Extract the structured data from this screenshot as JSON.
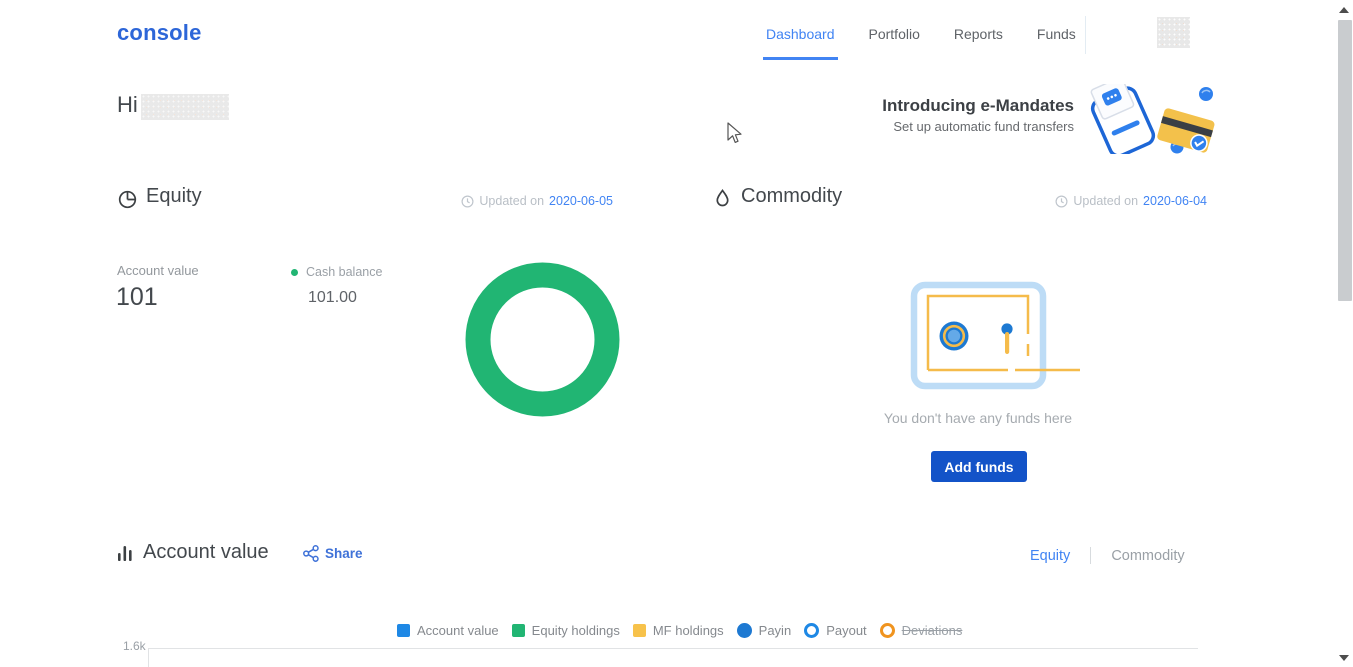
{
  "header": {
    "logo": "console",
    "nav": [
      {
        "label": "Dashboard",
        "active": true
      },
      {
        "label": "Portfolio",
        "active": false
      },
      {
        "label": "Reports",
        "active": false
      },
      {
        "label": "Funds",
        "active": false
      }
    ]
  },
  "greeting": {
    "prefix": "Hi"
  },
  "promo": {
    "title": "Introducing e-Mandates",
    "subtitle": "Set up automatic fund transfers"
  },
  "equity": {
    "title": "Equity",
    "updated_label": "Updated on",
    "updated_date": "2020-06-05",
    "account_value_label": "Account value",
    "account_value": "101",
    "cash_balance_label": "Cash balance",
    "cash_balance": "101.00"
  },
  "commodity": {
    "title": "Commodity",
    "updated_label": "Updated on",
    "updated_date": "2020-06-04",
    "empty_text": "You don't have any funds here",
    "add_funds_label": "Add funds"
  },
  "account_value_section": {
    "title": "Account value",
    "share_label": "Share",
    "toggle": [
      {
        "label": "Equity",
        "active": true
      },
      {
        "label": "Commodity",
        "active": false
      }
    ]
  },
  "equity_donut": {
    "type": "pie",
    "color": "#21b573",
    "series": [
      {
        "label": "Cash balance",
        "value": 101.0,
        "fraction": 1.0
      }
    ]
  },
  "chart_data": {
    "type": "line",
    "title": "Account value",
    "legend": [
      {
        "label": "Account value",
        "swatch": "square",
        "color": "#1e88e5"
      },
      {
        "label": "Equity holdings",
        "swatch": "square",
        "color": "#21b573"
      },
      {
        "label": "MF holdings",
        "swatch": "square",
        "color": "#f7c24b"
      },
      {
        "label": "Payin",
        "swatch": "circle-filled",
        "color": "#1d79d2"
      },
      {
        "label": "Payout",
        "swatch": "circle-outline",
        "color": "#1e88e5"
      },
      {
        "label": "Deviations",
        "swatch": "circle-outline",
        "color": "#f0941f",
        "disabled": true
      }
    ],
    "visible_y_ticks": [
      "1.6k"
    ]
  },
  "colors": {
    "accent_blue": "#4184f3",
    "button_blue": "#1353c8",
    "green": "#21b573",
    "heading_text": "#43484d",
    "muted_text": "#9aa0a6"
  }
}
